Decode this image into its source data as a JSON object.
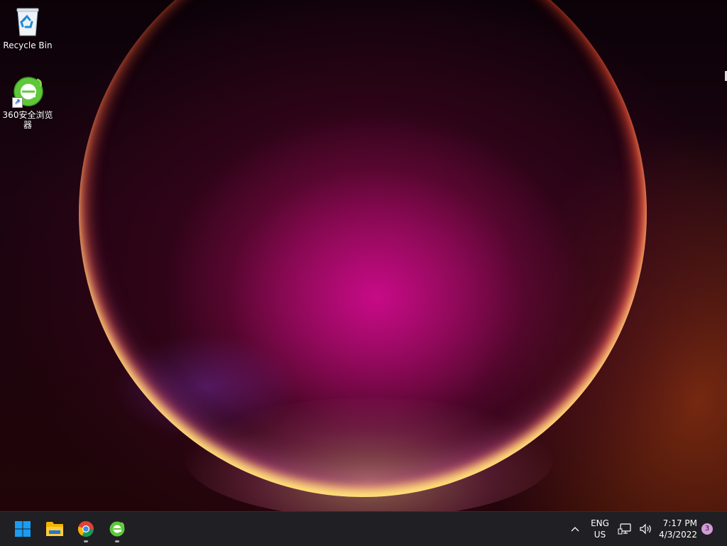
{
  "desktop": {
    "icons": [
      {
        "label": "Recycle Bin",
        "icon": "recycle-bin-icon"
      },
      {
        "label": "360安全浏览器",
        "icon": "360-browser-icon",
        "shortcut": true
      }
    ]
  },
  "taskbar": {
    "apps": [
      {
        "name": "start",
        "icon": "windows-logo-icon"
      },
      {
        "name": "file-explorer",
        "icon": "folder-icon"
      },
      {
        "name": "chrome",
        "icon": "chrome-icon",
        "running": true
      },
      {
        "name": "360-browser",
        "icon": "360-browser-icon",
        "running": true
      }
    ],
    "tray": {
      "language_top": "ENG",
      "language_bottom": "US",
      "time": "7:17 PM",
      "date": "4/3/2022",
      "notification_count": "3"
    }
  },
  "colors": {
    "taskbar_bg": "#201f23",
    "start_blue": "#1a9cf2",
    "badge": "#d59ad9",
    "browser_green": "#5fc73a"
  }
}
